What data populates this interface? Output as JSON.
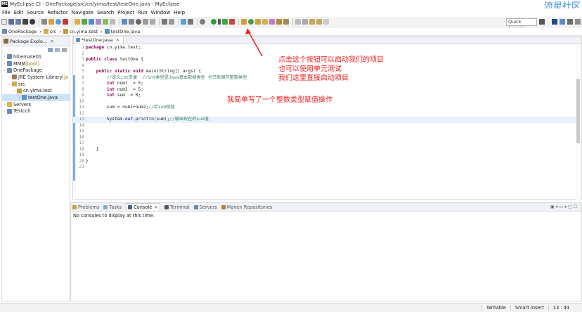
{
  "window": {
    "title": "MyEclipse CI - OnePackage/src/cn/yima/test/testOne.java - MyEclipse",
    "logo_text": "ME",
    "watermark": "流星社区"
  },
  "menu": [
    "File",
    "Edit",
    "Source",
    "Refactor",
    "Navigate",
    "Search",
    "Project",
    "Run",
    "Window",
    "Help"
  ],
  "toolbar": {
    "quick_access_label": "Quick Access"
  },
  "breadcrumb": [
    "OnePackage",
    "src",
    "cn.yima.test",
    "testOne.java"
  ],
  "explorer": {
    "tab_label": "Package Explo...",
    "items": [
      {
        "arrow": "›",
        "label": "hibernate01",
        "deco": ""
      },
      {
        "arrow": "›",
        "label": "MMM",
        "deco": " [boot]"
      },
      {
        "arrow": "⌄",
        "label": "OnePackage",
        "deco": ""
      },
      {
        "arrow": "›",
        "label": "JRE System Library",
        "deco": " [Ja"
      },
      {
        "arrow": "⌄",
        "label": "src",
        "deco": ""
      },
      {
        "arrow": "⌄",
        "label": "cn.yima.test",
        "deco": ""
      },
      {
        "arrow": "›",
        "label": "testOne.java",
        "deco": ""
      },
      {
        "arrow": "›",
        "label": "Servers",
        "deco": ""
      },
      {
        "arrow": "›",
        "label": "Testcch",
        "deco": ""
      }
    ]
  },
  "editor": {
    "tab_label": "*testOne.java",
    "lines": [
      {
        "n": "1",
        "t": "package cn.yima.test;"
      },
      {
        "n": "2",
        "t": ""
      },
      {
        "n": "3",
        "t": "public class testOne {"
      },
      {
        "n": "4",
        "t": ""
      },
      {
        "n": "5",
        "t": "    public static void main(String[] args) {"
      },
      {
        "n": "6",
        "t": "        //定义int变量  //int类型是Java基本数据类型 也只能储存整数类型"
      },
      {
        "n": "7",
        "t": "        int num1  = 5;"
      },
      {
        "n": "8",
        "t": "        int num2  = 5;"
      },
      {
        "n": "9",
        "t": "        int sum  = 0;"
      },
      {
        "n": "10",
        "t": ""
      },
      {
        "n": "11",
        "t": "        sum = num1+num2;//给sum赋值"
      },
      {
        "n": "12",
        "t": ""
      },
      {
        "n": "13",
        "t": "        System.out.println(sum);//输出现在的sum值"
      },
      {
        "n": "14",
        "t": ""
      },
      {
        "n": "15",
        "t": ""
      },
      {
        "n": "16",
        "t": ""
      },
      {
        "n": "17",
        "t": ""
      },
      {
        "n": "18",
        "t": "    }"
      },
      {
        "n": "19",
        "t": ""
      },
      {
        "n": "20",
        "t": "}"
      },
      {
        "n": "21",
        "t": ""
      }
    ]
  },
  "console": {
    "tabs": [
      "Problems",
      "Tasks",
      "Console",
      "Terminal",
      "Servers",
      "Maven Repositories"
    ],
    "active_tab": "Console",
    "message": "No consoles to display at this time."
  },
  "status": {
    "mode": "Writable",
    "insert": "Smart Insert",
    "position": "13 : 44"
  },
  "annotations": {
    "run_hint_1": "点击这个按钮可以启动我们的项目",
    "run_hint_2": "也可以使用单元测试",
    "run_hint_3": "我们这里直接启动项目",
    "code_hint": "我简单写了一个整数类型赋值操作"
  },
  "colors": {
    "annotation": "#ee1e1e",
    "keyword": "#7f0055",
    "comment": "#3f7f5f",
    "selection": "#cde3fb",
    "watermark": "#3b8fd8"
  }
}
